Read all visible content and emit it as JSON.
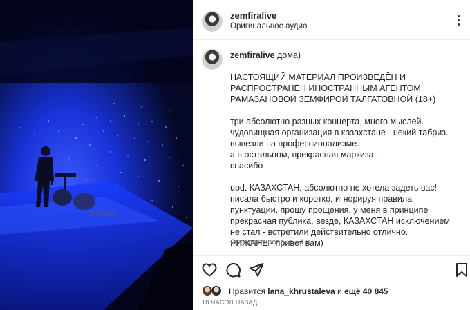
{
  "post": {
    "header": {
      "username": "zemfiralive",
      "audio": "Оригинальное аудио"
    },
    "caption": {
      "username": "zemfiralive",
      "first_line": "дома)",
      "notice": "НАСТОЯЩИЙ МАТЕРИАЛ ПРОИЗВЕДЁН И РАСПРОСТРАНЁН ИНОСТРАННЫМ АГЕНТОМ РАМАЗАНОВОЙ ЗЕМФИРОЙ ТАЛГАТОВНОЙ (18+)",
      "lines": [
        "три абсолютно разных концерта, много мыслей.",
        "чудовищная организация в казахстане - некий табриз.",
        "вывезли на профессионализме.",
        "а в остальном, прекрасная маркиза..",
        "спасибо"
      ],
      "update": "upd. КАЗАХСТАН, абсолютно не хотела задеть вас! писала быстро и коротко, игнорируя правила пунктуации. прошу прощения. у меня в принципе прекрасная публика, везде, КАЗАХСТАН исключением не стал - встретили действительно отлично.",
      "greeting": "РИЖАНЕ - привет вам)",
      "meta": "Отредактировано · 4 ч."
    },
    "likes": {
      "prefix": "Нравится",
      "user": "lana_khrustaleva",
      "middle": "и",
      "count": "ещё 40 845"
    },
    "timestamp": "18 часов назад"
  },
  "colors": {
    "stage_blue": "#1a3cff",
    "text": "#262626",
    "secondary": "#737373"
  },
  "icons": [
    "more-icon",
    "heart-icon",
    "comment-icon",
    "share-icon",
    "bookmark-icon"
  ]
}
